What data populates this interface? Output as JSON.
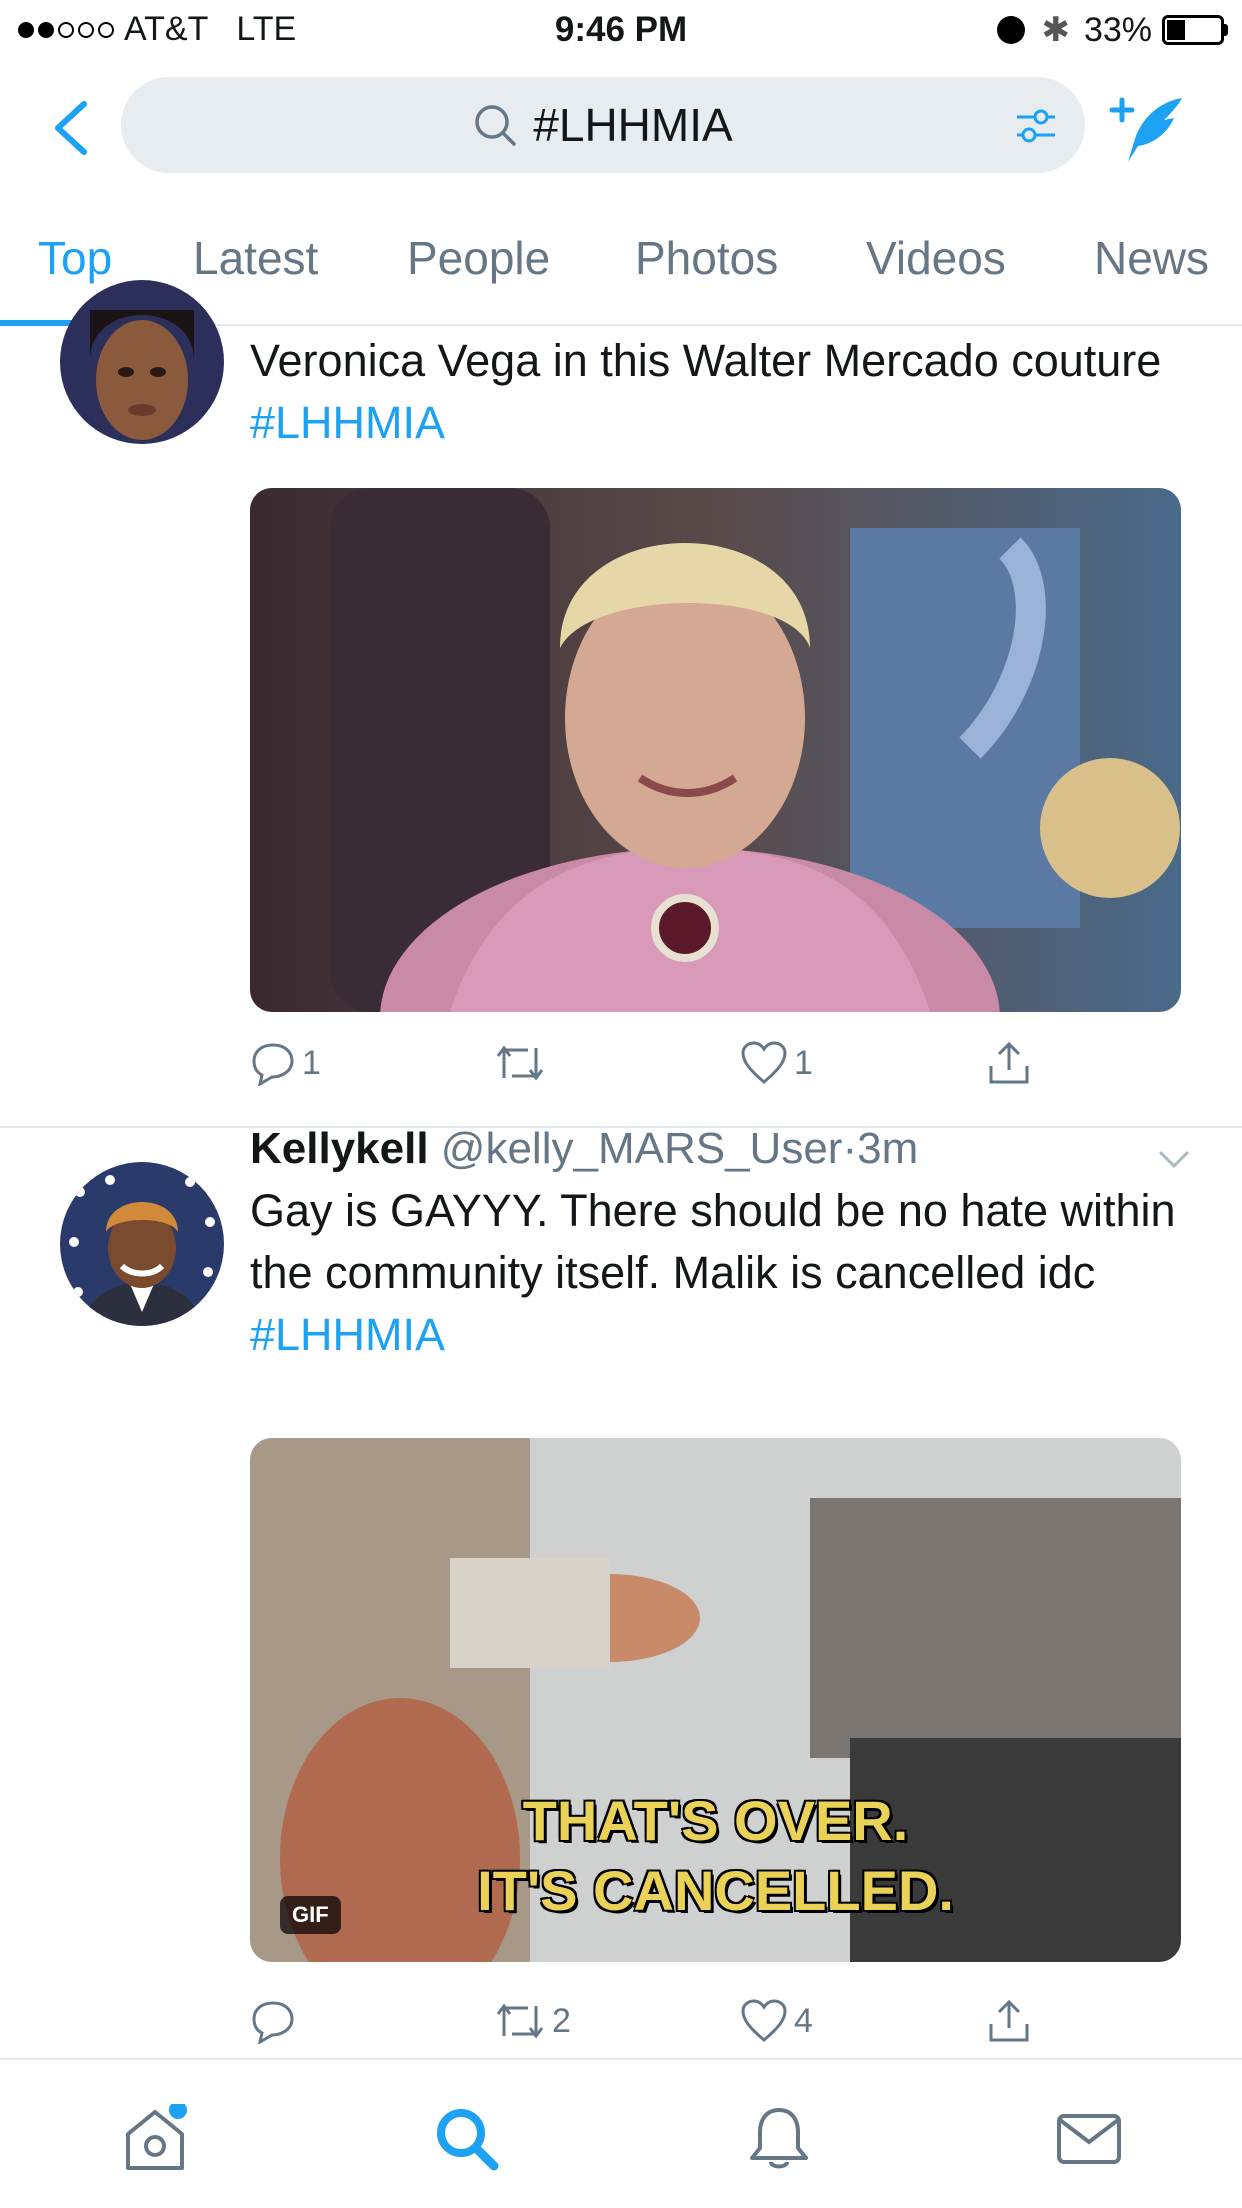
{
  "status_bar": {
    "carrier": "AT&T",
    "network": "LTE",
    "time": "9:46 PM",
    "battery": "33%",
    "battery_level": 0.33
  },
  "search": {
    "query": "#LHHMIA"
  },
  "tabs": [
    {
      "label": "Top",
      "active": true
    },
    {
      "label": "Latest",
      "active": false
    },
    {
      "label": "People",
      "active": false
    },
    {
      "label": "Photos",
      "active": false
    },
    {
      "label": "Videos",
      "active": false
    },
    {
      "label": "News",
      "active": false
    }
  ],
  "tweets": [
    {
      "text": "Veronica Vega in this Walter Mercado couture ",
      "hashtag": "#LHHMIA",
      "media_type": "image",
      "actions": {
        "reply": "1",
        "retweet": "",
        "like": "1"
      }
    },
    {
      "name": "Kellykell",
      "handle": "@kelly_MARS_User",
      "separator": "·",
      "time": "3m",
      "text": "Gay is GAYYY. There should be no hate within the community itself. Malik is cancelled idc ",
      "hashtag": "#LHHMIA",
      "media_type": "gif",
      "gif_badge": "GIF",
      "gif_caption_line1": "THAT'S OVER.",
      "gif_caption_line2": "IT'S CANCELLED.",
      "actions": {
        "reply": "",
        "retweet": "2",
        "like": "4"
      }
    }
  ],
  "bottom_nav": [
    {
      "icon": "home-icon",
      "active": false,
      "notification_dot": true
    },
    {
      "icon": "search-icon",
      "active": true
    },
    {
      "icon": "bell-icon",
      "active": false
    },
    {
      "icon": "mail-icon",
      "active": false
    }
  ],
  "colors": {
    "accent": "#1da1f2",
    "text": "#14171a",
    "secondary": "#657786",
    "search_bg": "#e6ecf0",
    "divider": "#e1e8ed"
  }
}
